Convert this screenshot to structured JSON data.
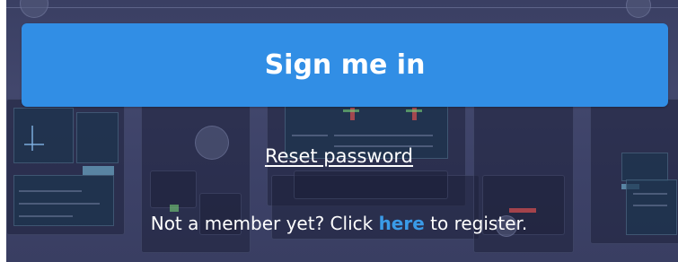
{
  "signin": {
    "button_label": "Sign me in"
  },
  "reset": {
    "link_label": "Reset password"
  },
  "register": {
    "prefix": "Not a member yet? Click ",
    "link_label": "here",
    "suffix": " to register."
  },
  "colors": {
    "button": "#318ee5",
    "link_accent": "#3a9be8",
    "background": "#3d4268"
  }
}
